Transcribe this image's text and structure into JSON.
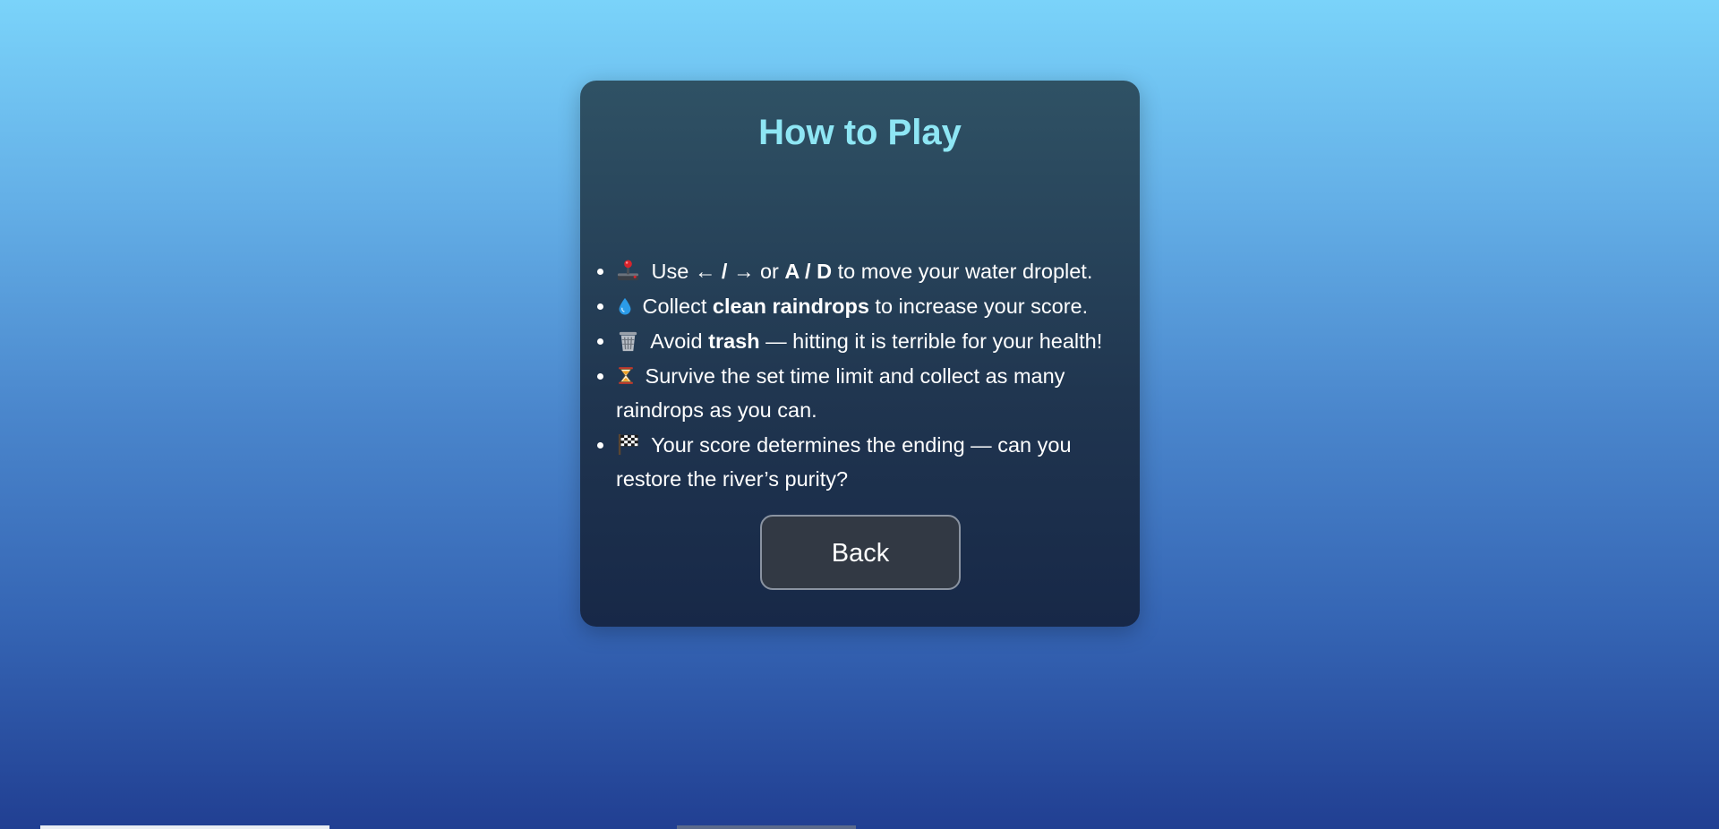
{
  "panel": {
    "title": "How to Play",
    "rules": [
      {
        "icon": "joystick-icon",
        "segments": [
          {
            "text": " Use ",
            "bold": false
          },
          {
            "text": "← / →",
            "bold": false
          },
          {
            "text": " or ",
            "bold": false
          },
          {
            "text": "A / D",
            "bold": true
          },
          {
            "text": " to move your water droplet.",
            "bold": false
          }
        ]
      },
      {
        "icon": "droplet-icon",
        "segments": [
          {
            "text": " Collect ",
            "bold": false
          },
          {
            "text": "clean raindrops",
            "bold": true
          },
          {
            "text": " to increase your score.",
            "bold": false
          }
        ]
      },
      {
        "icon": "wastebasket-icon",
        "segments": [
          {
            "text": " Avoid ",
            "bold": false
          },
          {
            "text": "trash",
            "bold": true
          },
          {
            "text": " — hitting it is terrible for your health!",
            "bold": false
          }
        ]
      },
      {
        "icon": "hourglass-icon",
        "segments": [
          {
            "text": " Survive the set time limit and collect as many raindrops as you can.",
            "bold": false
          }
        ]
      },
      {
        "icon": "checkered-flag-icon",
        "segments": [
          {
            "text": " Your score determines the ending — can you restore the river’s purity?",
            "bold": false
          }
        ]
      }
    ],
    "back_label": "Back"
  },
  "colors": {
    "title": "#8ee6f4",
    "panel_bg": "#1e324b",
    "button_bg": "#323944",
    "button_border": "#8a93a1",
    "background_top": "#7ad3fa",
    "background_bottom": "#213f92"
  }
}
